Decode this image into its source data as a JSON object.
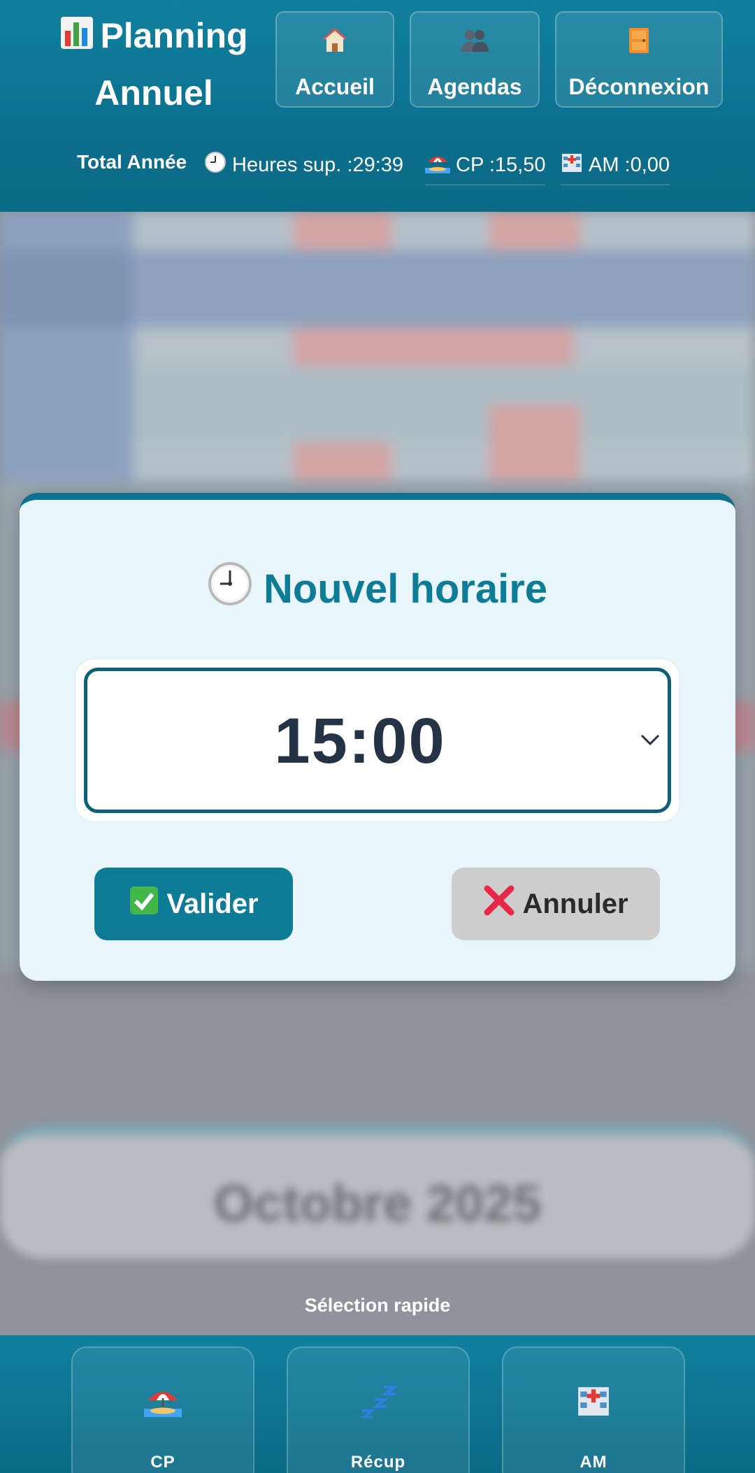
{
  "header": {
    "title_line1": "Planning",
    "title_line2": "Annuel",
    "title_icon": "bar-chart-icon",
    "nav": [
      {
        "label": "Accueil",
        "icon": "house-icon"
      },
      {
        "label": "Agendas",
        "icon": "people-icon"
      },
      {
        "label": "Déconnexion",
        "icon": "door-icon"
      }
    ]
  },
  "totals": {
    "label": "Total Année",
    "overtime": "Heures sup. :29:39",
    "cp": "CP :15,50",
    "am": "AM :0,00"
  },
  "background": {
    "month_label": "Octobre 2025"
  },
  "modal": {
    "title": "Nouvel horaire",
    "time_value": "15:00",
    "validate_label": "Valider",
    "cancel_label": "Annuler"
  },
  "quick_select": {
    "title": "Sélection rapide",
    "items": [
      {
        "label": "CP",
        "icon": "beach-umbrella-icon"
      },
      {
        "label": "Récup",
        "icon": "sleep-zzz-icon"
      },
      {
        "label": "AM",
        "icon": "hospital-icon"
      }
    ]
  },
  "colors": {
    "header_bg": "#10809e",
    "accent": "#0e7b97",
    "modal_bg": "#e8f5fb",
    "cancel_bg": "#cdcdcd"
  }
}
